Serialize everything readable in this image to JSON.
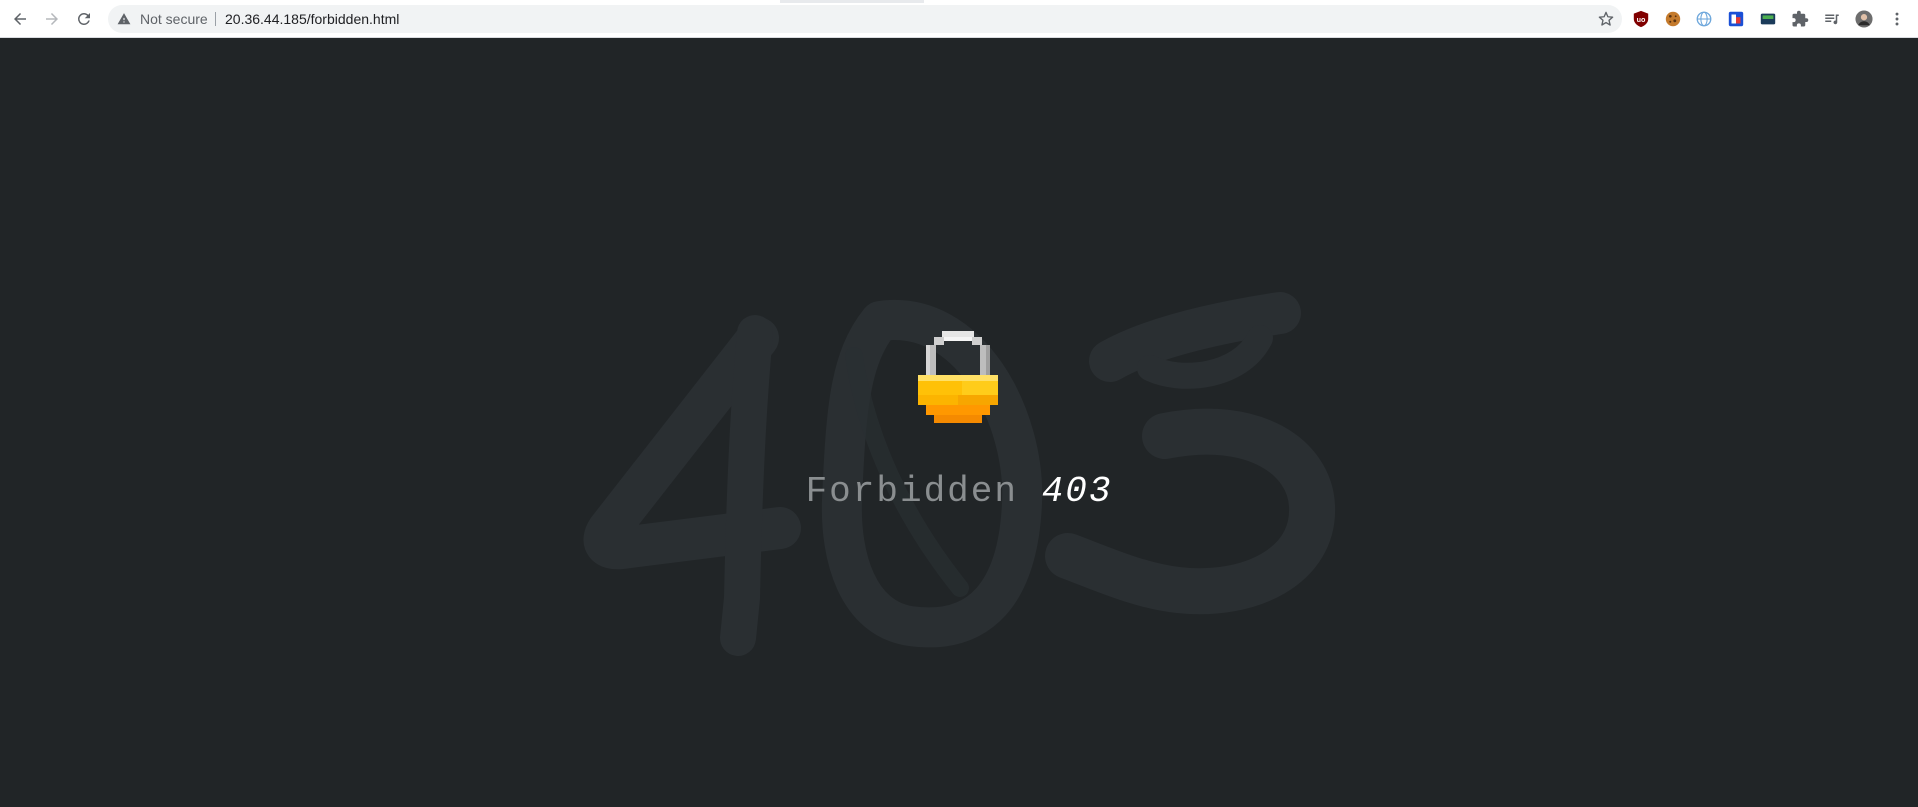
{
  "browser": {
    "security_status": "Not secure",
    "url": "20.36.44.185/forbidden.html",
    "icons": {
      "back": "arrow-left-icon",
      "forward": "arrow-right-icon",
      "reload": "reload-icon",
      "warning": "warning-triangle-icon",
      "bookmark": "star-icon",
      "menu": "kebab-menu-icon"
    },
    "extensions": [
      "ublock-origin-icon",
      "cookie-icon",
      "globe-icon",
      "flag-extension-icon",
      "screen-extension-icon",
      "puzzle-piece-icon",
      "reading-list-icon",
      "profile-avatar"
    ]
  },
  "page": {
    "background_color": "#212527",
    "watermark": "403",
    "lock_icon": "padlock-icon",
    "message": {
      "word": "Forbidden",
      "code": "403"
    },
    "colors": {
      "word": "#8a8e90",
      "code": "#ffffff",
      "lock_body": "#f6b80f",
      "lock_shackle": "#bdbdbd"
    }
  }
}
